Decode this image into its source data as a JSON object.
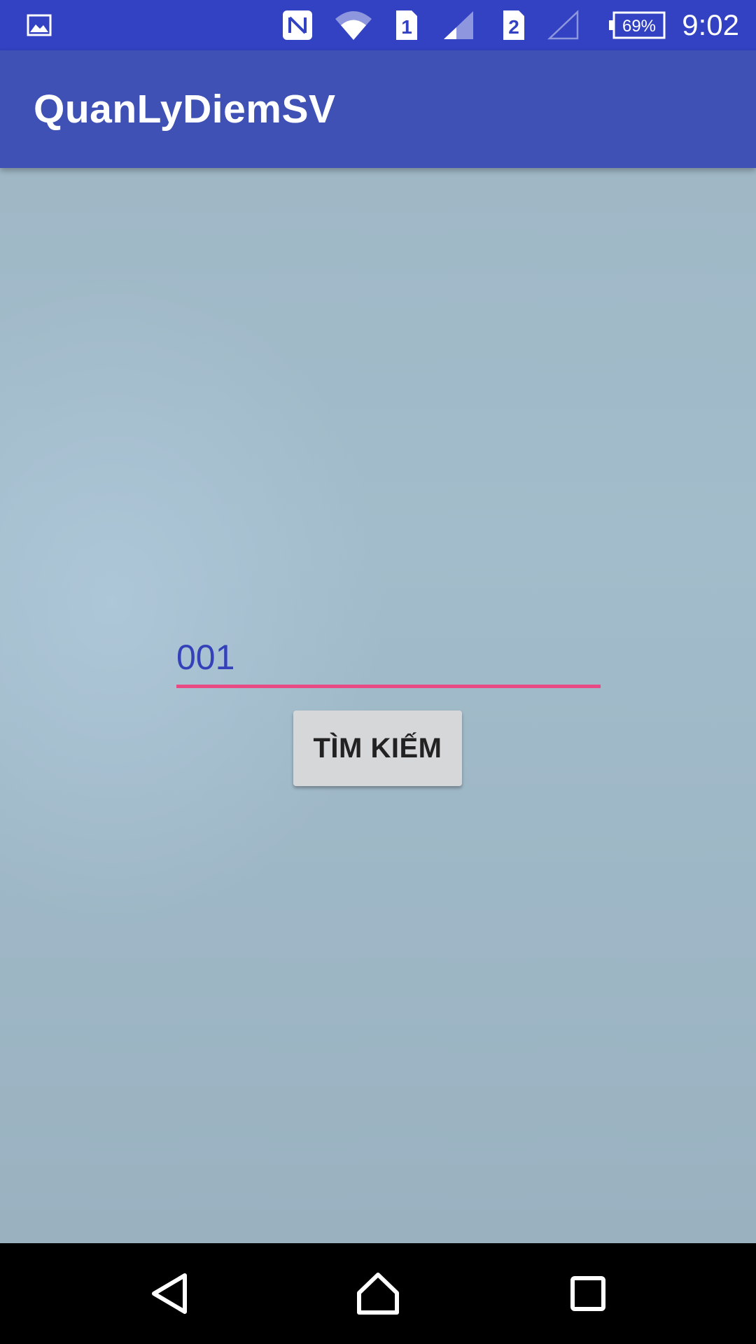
{
  "status_bar": {
    "time": "9:02",
    "battery_level": "69%",
    "sim1_label": "1",
    "sim2_label": "2",
    "icons": [
      "image-notification-icon",
      "nfc-icon",
      "wifi-icon",
      "sim1-icon",
      "signal-icon",
      "sim2-icon",
      "signal-empty-icon",
      "battery-icon"
    ],
    "background_color": "#3242c2"
  },
  "app_bar": {
    "title": "QuanLyDiemSV",
    "background_color": "#3f51b5"
  },
  "main": {
    "search_input": {
      "value": "001",
      "text_color": "#3441b8",
      "underline_color": "#e94a83"
    },
    "search_button": {
      "label": "TÌM KIẾM"
    }
  },
  "nav_bar": {
    "icons": [
      "back-icon",
      "home-icon",
      "recent-apps-icon"
    ]
  }
}
